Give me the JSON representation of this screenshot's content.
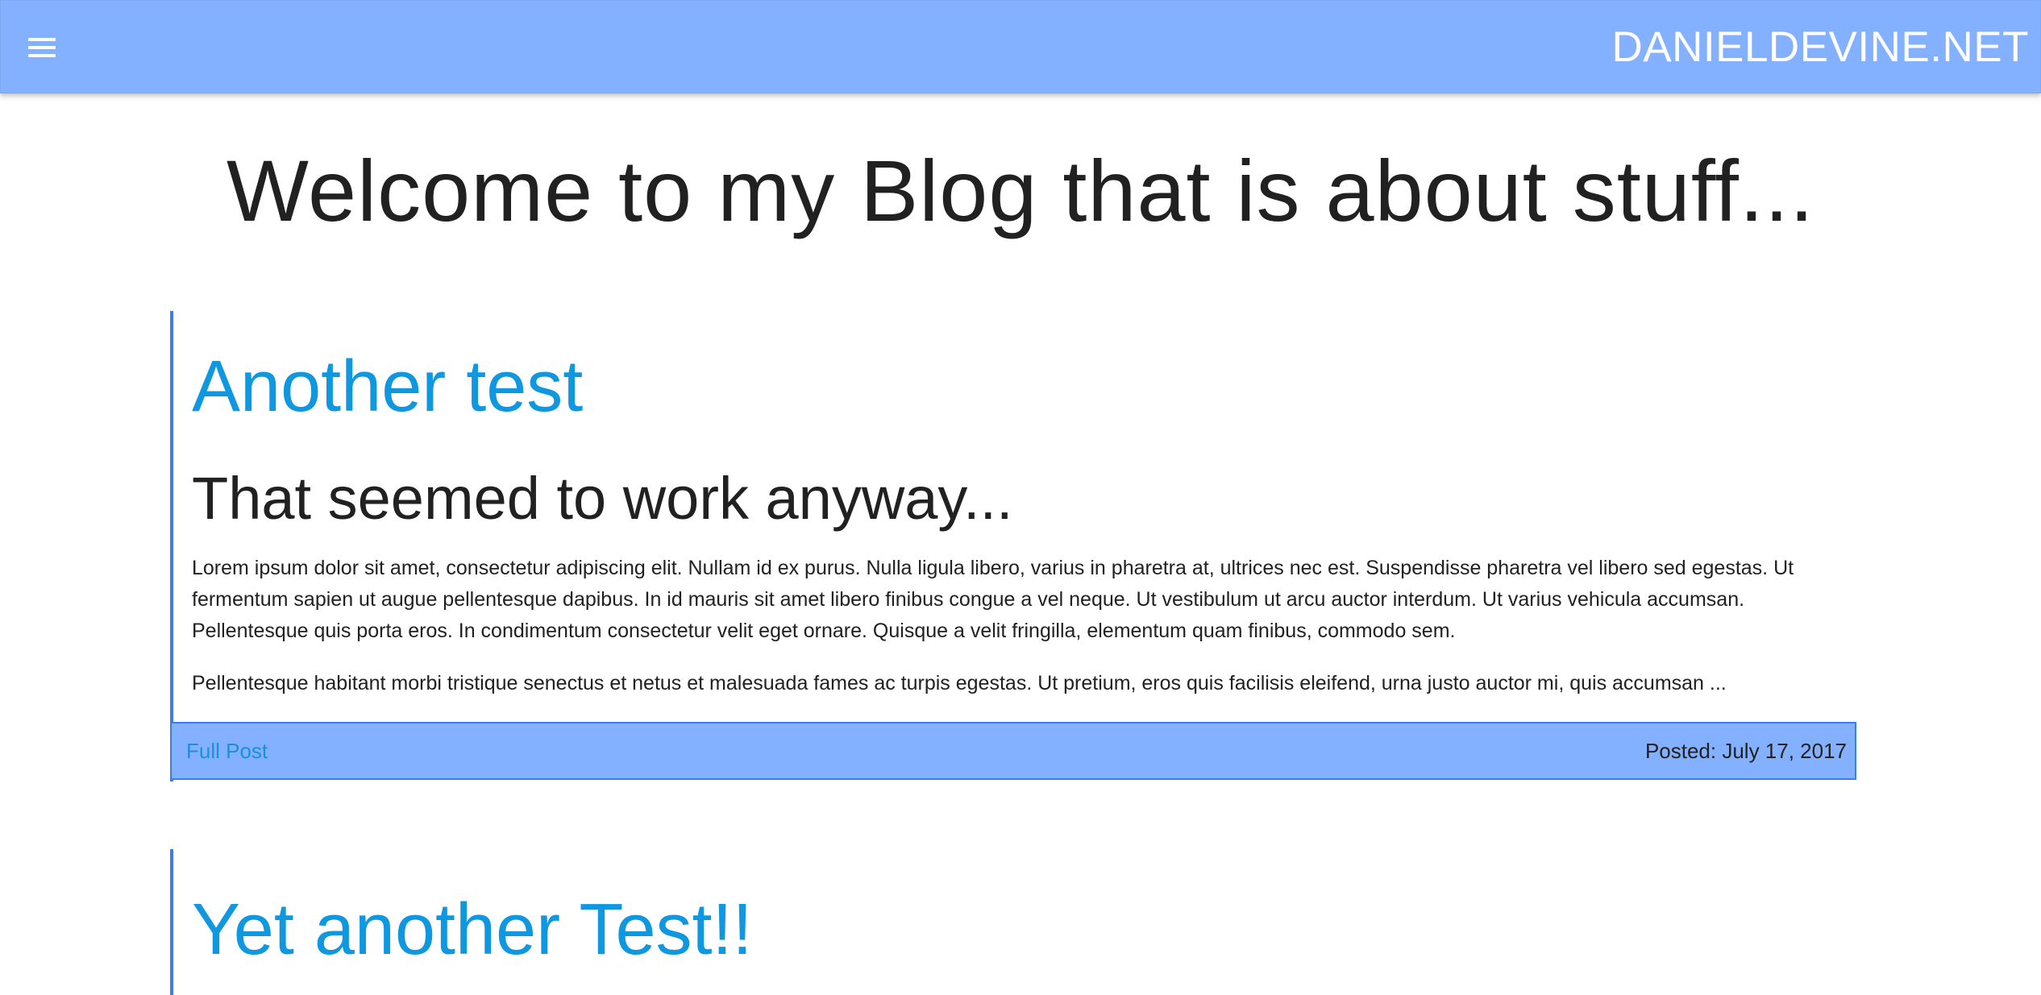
{
  "header": {
    "menu_icon": "hamburger-menu-icon",
    "site_title": "DANIELDEVINE.NET",
    "bar_color": "#84b1ff"
  },
  "main": {
    "page_title": "Welcome to my Blog that is about stuff..."
  },
  "posts": [
    {
      "title": "Another test",
      "subtitle": "That seemed to work anyway...",
      "paragraphs": [
        "Lorem ipsum dolor sit amet, consectetur adipiscing elit. Nullam id ex purus. Nulla ligula libero, varius in pharetra at, ultrices nec est. Suspendisse pharetra vel libero sed egestas. Ut fermentum sapien ut augue pellentesque dapibus. In id mauris sit amet libero finibus congue a vel neque. Ut vestibulum ut arcu auctor interdum. Ut varius vehicula accumsan. Pellentesque quis porta eros. In condimentum consectetur velit eget ornare. Quisque a velit fringilla, elementum quam finibus, commodo sem.",
        "Pellentesque habitant morbi tristique senectus et netus et malesuada fames ac turpis egestas. Ut pretium, eros quis facilisis eleifend, urna justo auctor mi, quis accumsan ..."
      ],
      "link_label": "Full Post",
      "posted": "Posted: July 17, 2017"
    },
    {
      "title": "Yet another Test!!"
    }
  ],
  "colors": {
    "accent_blue": "#0f98e0",
    "border_blue": "#3b7cf2"
  }
}
